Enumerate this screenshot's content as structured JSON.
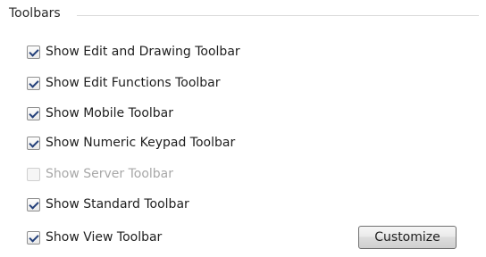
{
  "group": {
    "title": "Toolbars"
  },
  "options": [
    {
      "label": "Show Edit and Drawing Toolbar",
      "checked": true,
      "enabled": true
    },
    {
      "label": "Show Edit Functions Toolbar",
      "checked": true,
      "enabled": true
    },
    {
      "label": "Show Mobile Toolbar",
      "checked": true,
      "enabled": true
    },
    {
      "label": "Show Numeric Keypad Toolbar",
      "checked": true,
      "enabled": true
    },
    {
      "label": "Show Server Toolbar",
      "checked": false,
      "enabled": false
    },
    {
      "label": "Show Standard Toolbar",
      "checked": true,
      "enabled": true
    },
    {
      "label": "Show View Toolbar",
      "checked": true,
      "enabled": true
    }
  ],
  "buttons": {
    "customize_label": "Customize"
  }
}
